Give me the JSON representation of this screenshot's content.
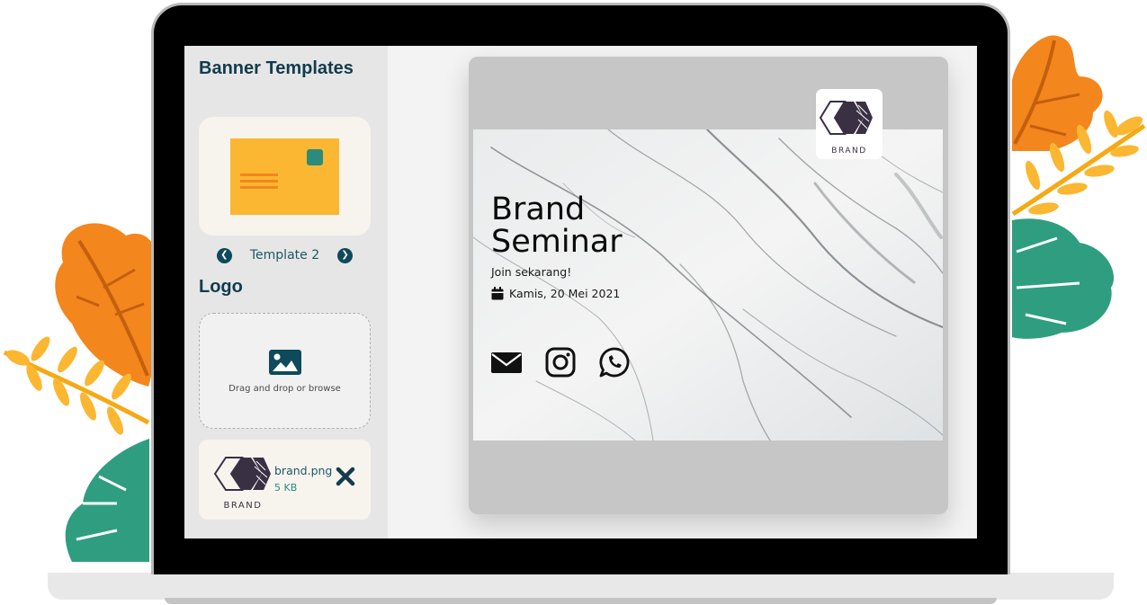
{
  "sidebar": {
    "title": "Banner Templates",
    "template_nav": {
      "prev_icon": "chevron-left-icon",
      "current": "Template 2",
      "next_icon": "chevron-right-icon"
    },
    "logo_section_title": "Logo",
    "dropzone": {
      "icon": "image-icon",
      "text": "Drag and drop or browse"
    },
    "uploaded_file": {
      "name": "brand.png",
      "size": "5 KB",
      "thumb_label": "BRAND",
      "remove_icon": "close-icon"
    }
  },
  "banner": {
    "title_line1": "Brand",
    "title_line2": "Seminar",
    "subtitle": "Join sekarang!",
    "date": "Kamis, 20 Mei 2021",
    "date_icon": "calendar-icon",
    "logo_label": "BRAND",
    "socials": [
      "envelope-icon",
      "instagram-icon",
      "whatsapp-icon"
    ]
  },
  "colors": {
    "navy": "#123b4e",
    "teal": "#2a8c7d",
    "template_yellow": "#fbb731",
    "leaf_orange": "#f3861d",
    "leaf_yellow": "#fbb731",
    "leaf_green": "#2f9e80"
  }
}
